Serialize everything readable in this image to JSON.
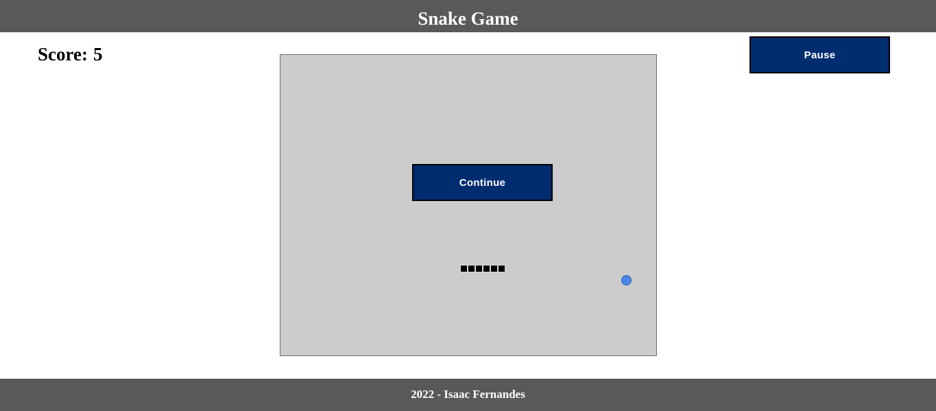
{
  "header": {
    "title": "Snake Game"
  },
  "score": {
    "label": "Score:",
    "value": "5"
  },
  "controls": {
    "pause_label": "Pause"
  },
  "board": {
    "continue_label": "Continue",
    "snake_length": 6,
    "colors": {
      "background": "#cccccc",
      "snake": "#000000",
      "food": "#4c86e6"
    }
  },
  "footer": {
    "text": "2022 - Isaac Fernandes"
  },
  "colors": {
    "bar": "#595959",
    "button": "#002c70"
  }
}
